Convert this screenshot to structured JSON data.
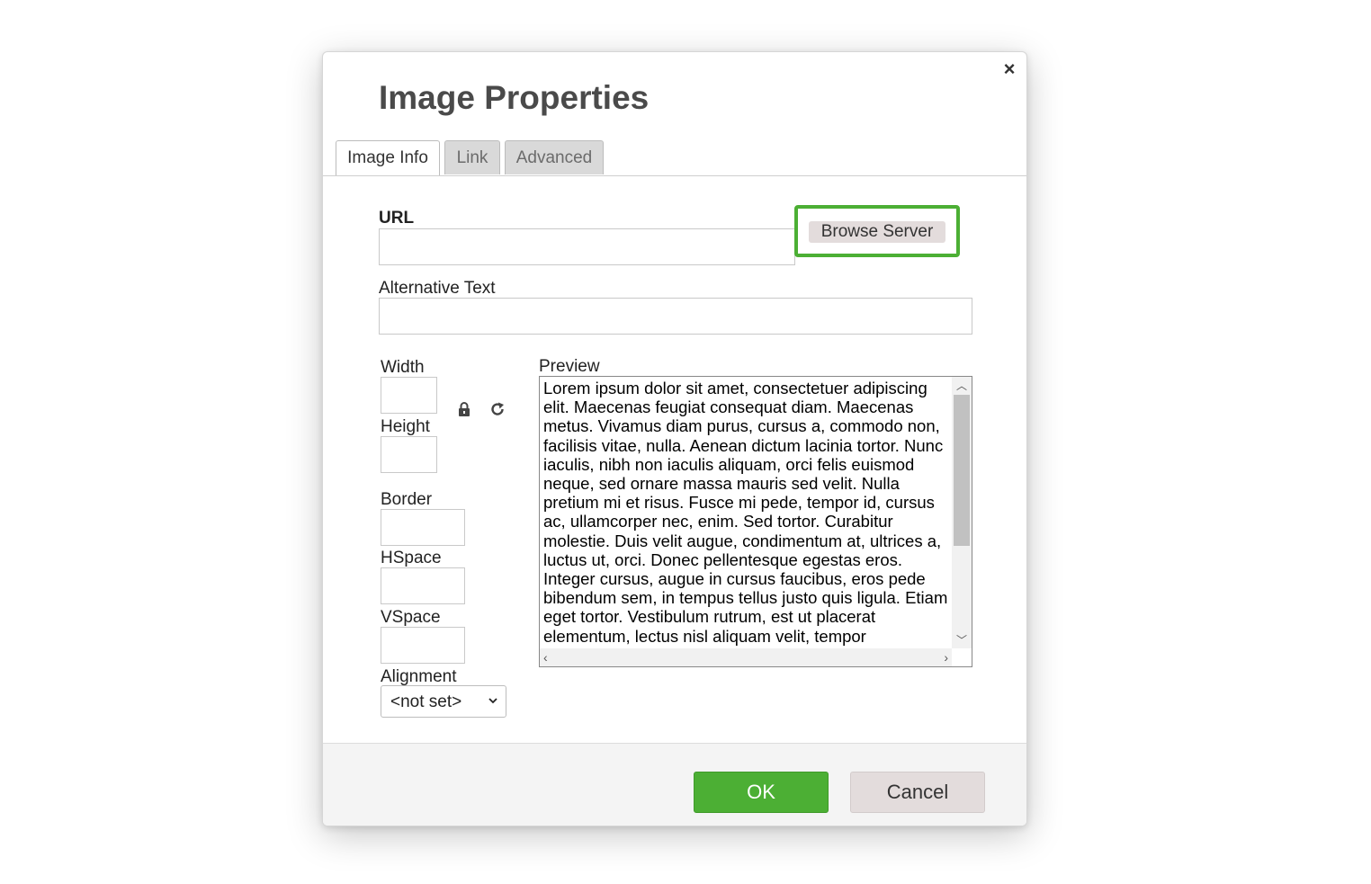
{
  "dialog": {
    "title": "Image Properties",
    "close_symbol": "×",
    "close_icon": "close-icon"
  },
  "tabs": [
    {
      "label": "Image Info",
      "active": true
    },
    {
      "label": "Link",
      "active": false
    },
    {
      "label": "Advanced",
      "active": false
    }
  ],
  "image_info": {
    "url_label": "URL",
    "url_value": "",
    "browse_label": "Browse Server",
    "browse_highlight_color": "#4caf34",
    "alt_label": "Alternative Text",
    "alt_value": "",
    "width_label": "Width",
    "width_value": "",
    "height_label": "Height",
    "height_value": "",
    "lock_icon": "lock-icon",
    "reset_icon": "reset-size-icon",
    "border_label": "Border",
    "border_value": "",
    "hspace_label": "HSpace",
    "hspace_value": "",
    "vspace_label": "VSpace",
    "vspace_value": "",
    "alignment_label": "Alignment",
    "alignment_value": "<not set>",
    "preview_label": "Preview",
    "preview_text": "Lorem ipsum dolor sit amet, consectetuer adipiscing elit. Maecenas feugiat consequat diam. Maecenas metus. Vivamus diam purus, cursus a, commodo non, facilisis vitae, nulla. Aenean dictum lacinia tortor. Nunc iaculis, nibh non iaculis aliquam, orci felis euismod neque, sed ornare massa mauris sed velit. Nulla pretium mi et risus. Fusce mi pede, tempor id, cursus ac, ullamcorper nec, enim. Sed tortor. Curabitur molestie. Duis velit augue, condimentum at, ultrices a, luctus ut, orci. Donec pellentesque egestas eros. Integer cursus, augue in cursus faucibus, eros pede bibendum sem, in tempus tellus justo quis ligula. Etiam eget tortor. Vestibulum rutrum, est ut placerat elementum, lectus nisl aliquam velit, tempor"
  },
  "footer": {
    "ok_label": "OK",
    "cancel_label": "Cancel",
    "ok_color": "#4caf34"
  }
}
